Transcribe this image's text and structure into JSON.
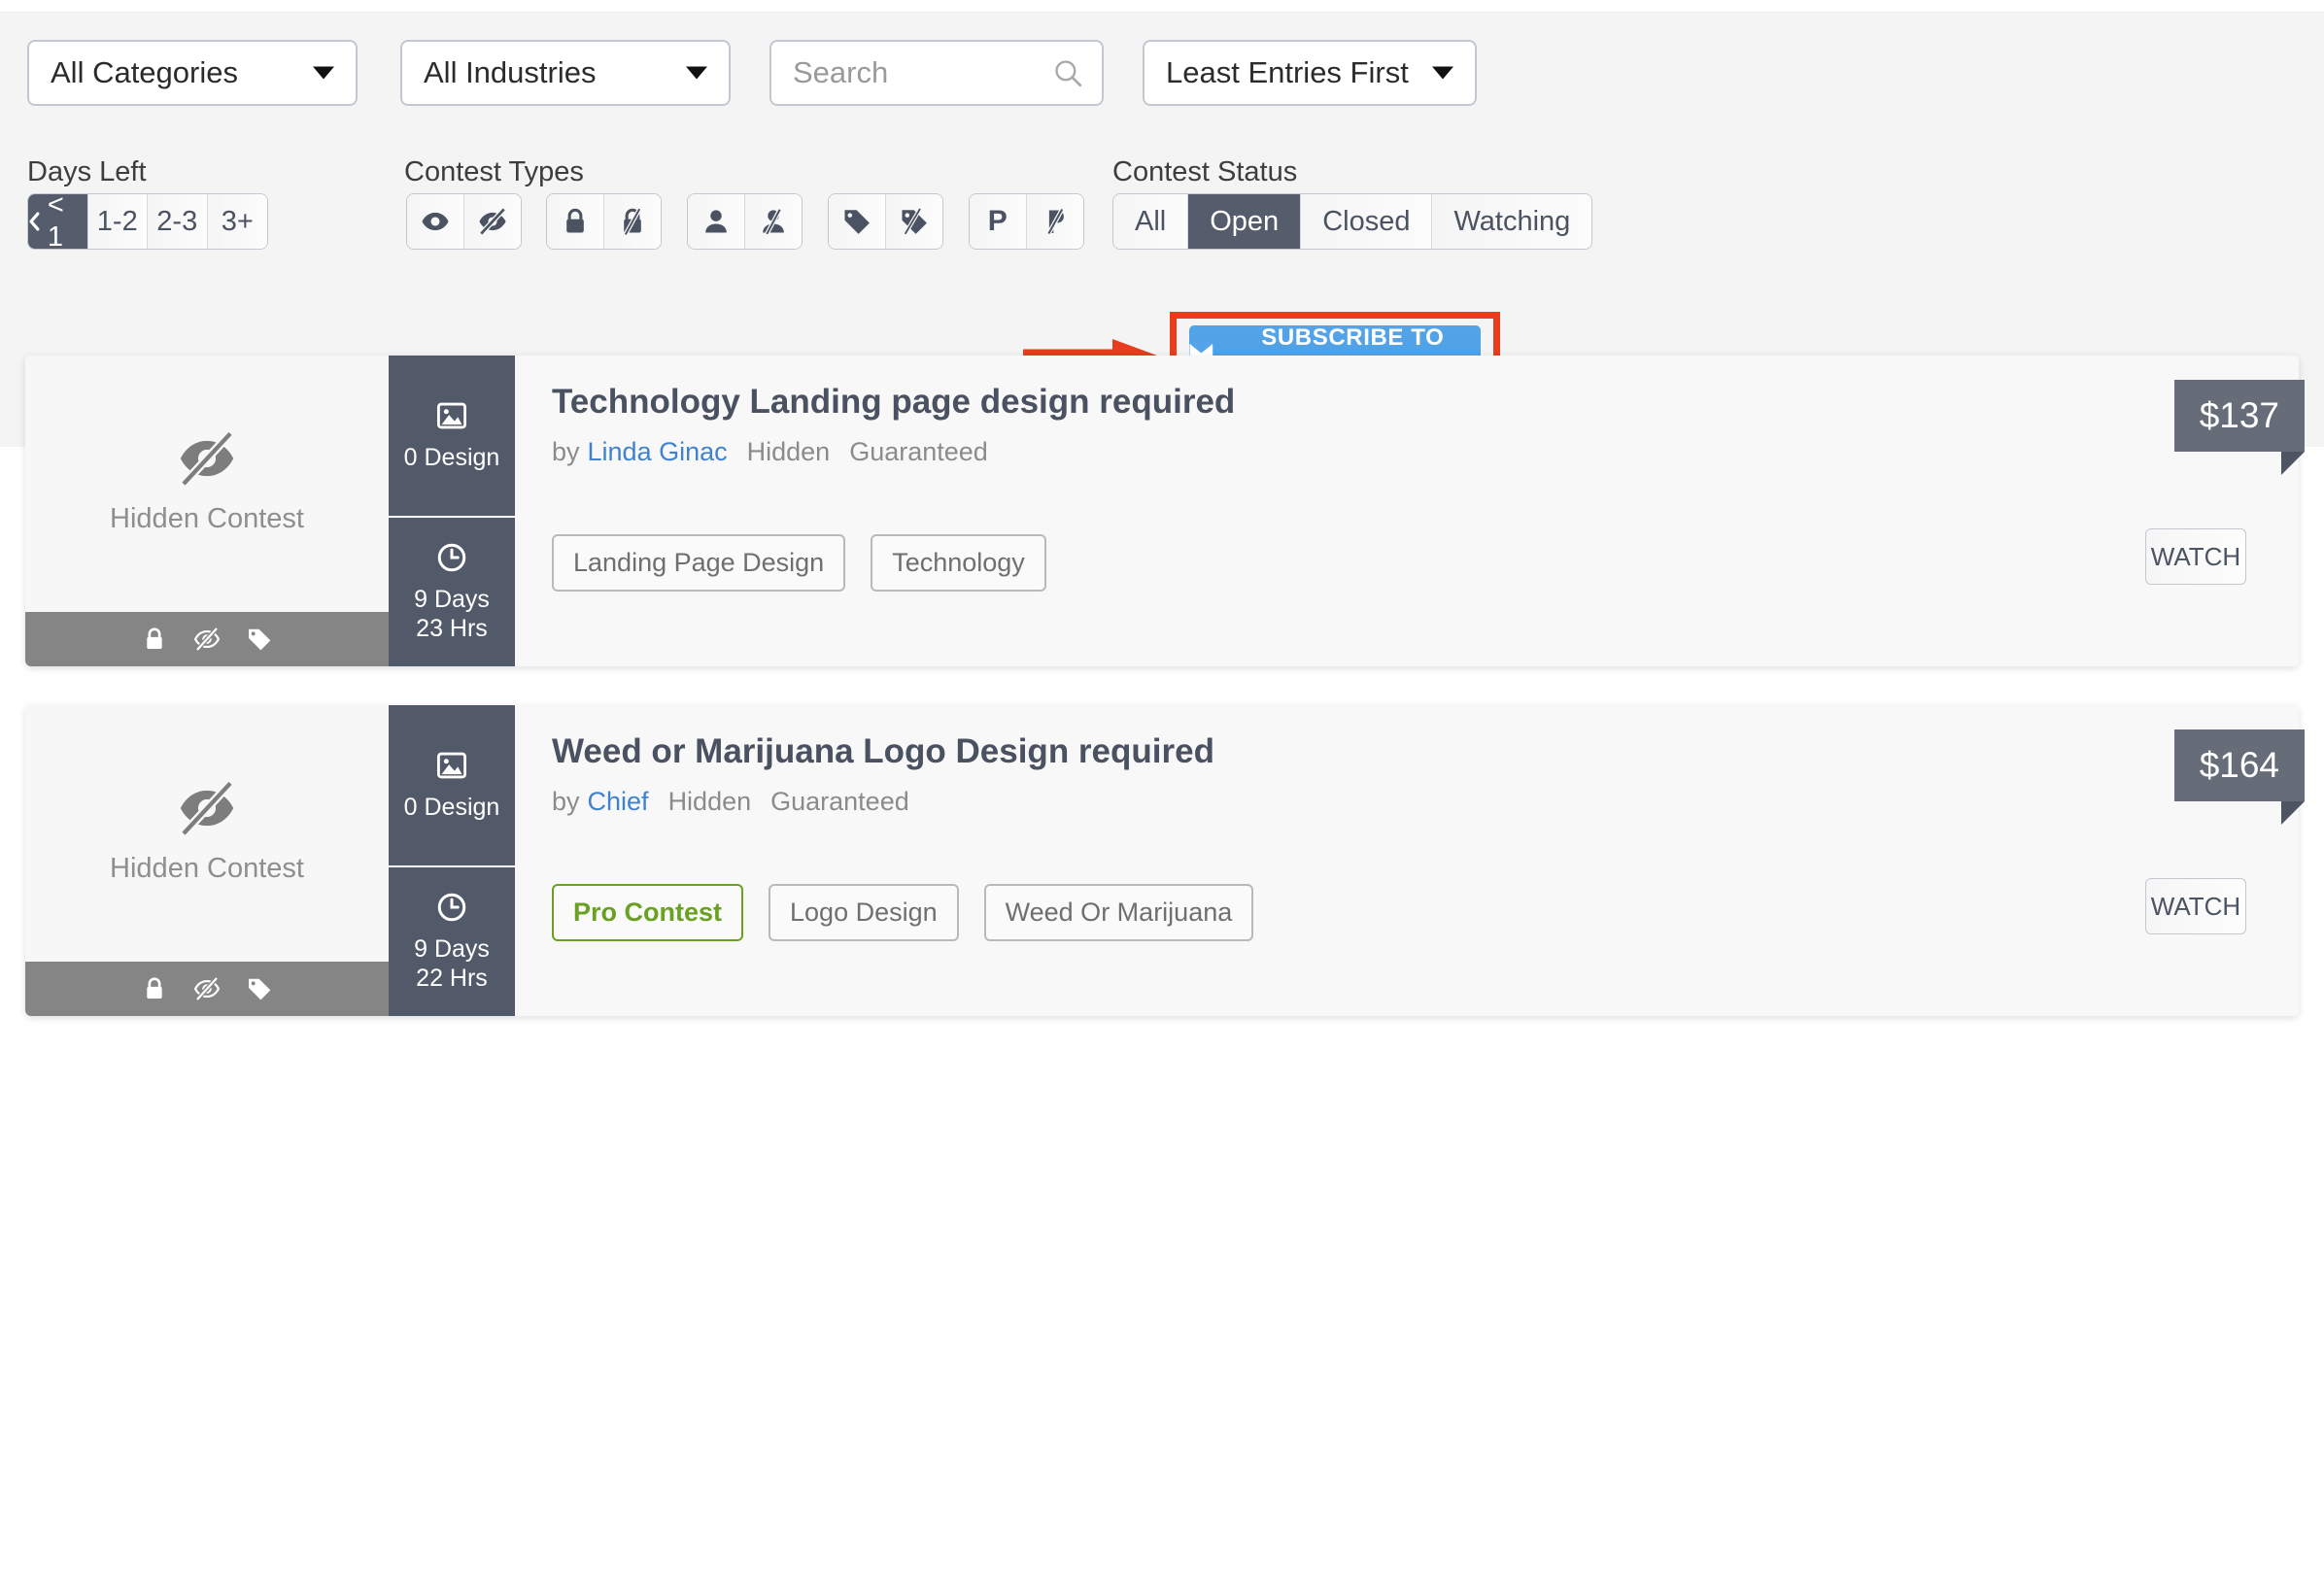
{
  "filters": {
    "category_select": {
      "value": "All Categories",
      "icon": "chevron-down-icon"
    },
    "industry_select": {
      "value": "All Industries",
      "icon": "chevron-down-icon"
    },
    "search": {
      "value": "",
      "placeholder": "Search",
      "icon": "search-icon"
    },
    "sort_select": {
      "value": "Least Entries First",
      "icon": "chevron-down-icon"
    },
    "days_left": {
      "label": "Days Left",
      "options": [
        "< 1",
        "1-2",
        "2-3",
        "3+"
      ],
      "active": "< 1"
    },
    "contest_types": {
      "label": "Contest Types",
      "groups": [
        {
          "icons": [
            "eye-icon",
            "eye-slash-icon"
          ]
        },
        {
          "icons": [
            "lock-icon",
            "lock-slash-icon"
          ]
        },
        {
          "icons": [
            "user-icon",
            "user-slash-icon"
          ]
        },
        {
          "icons": [
            "tag-icon",
            "tag-slash-icon"
          ]
        },
        {
          "icons": [
            "pro-p-icon",
            "pro-p-slash-icon"
          ]
        }
      ]
    },
    "contest_status": {
      "label": "Contest Status",
      "options": [
        "All",
        "Open",
        "Closed",
        "Watching"
      ],
      "active": "Open"
    }
  },
  "subscribe": {
    "label": "SUBSCRIBE TO ALERT",
    "icon": "envelope-icon",
    "color": "#53a4e8",
    "annotation_color": "#ea3b1d"
  },
  "contests": [
    {
      "thumb_label": "Hidden Contest",
      "thumb_icon": "eye-slash-icon",
      "thumb_foot_icons": [
        "lock-icon",
        "eye-slash-icon",
        "tag-icon"
      ],
      "entries_count": "0 Design",
      "entries_icon": "image-icon",
      "time_left": "9 Days 23 Hrs",
      "time_icon": "clock-icon",
      "title": "Technology Landing page design required",
      "by_label": "by",
      "author": "Linda Ginac",
      "badges": [
        "Hidden",
        "Guaranteed"
      ],
      "tags": [
        {
          "label": "Landing Page Design",
          "pro": false
        },
        {
          "label": "Technology",
          "pro": false
        }
      ],
      "watch_label": "WATCH",
      "price": "$137"
    },
    {
      "thumb_label": "Hidden Contest",
      "thumb_icon": "eye-slash-icon",
      "thumb_foot_icons": [
        "lock-icon",
        "eye-slash-icon",
        "tag-icon"
      ],
      "entries_count": "0 Design",
      "entries_icon": "image-icon",
      "time_left": "9 Days 22 Hrs",
      "time_icon": "clock-icon",
      "title": "Weed or Marijuana Logo Design required",
      "by_label": "by",
      "author": "Chief",
      "badges": [
        "Hidden",
        "Guaranteed"
      ],
      "tags": [
        {
          "label": "Pro Contest",
          "pro": true
        },
        {
          "label": "Logo Design",
          "pro": false
        },
        {
          "label": "Weed Or Marijuana",
          "pro": false
        }
      ],
      "watch_label": "WATCH",
      "price": "$164"
    }
  ]
}
